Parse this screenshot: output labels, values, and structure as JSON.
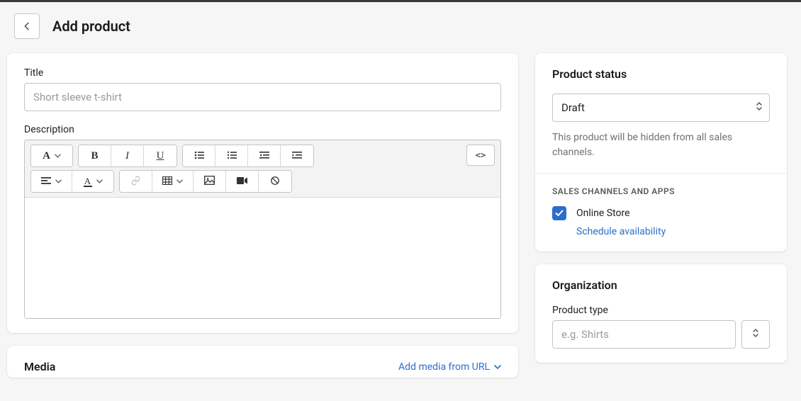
{
  "header": {
    "title": "Add product"
  },
  "main": {
    "title_label": "Title",
    "title_placeholder": "Short sleeve t-shirt",
    "description_label": "Description",
    "media": {
      "title": "Media",
      "add_url_label": "Add media from URL"
    },
    "rte_code_label": "<>"
  },
  "sidebar": {
    "status": {
      "title": "Product status",
      "selected": "Draft",
      "helper": "This product will be hidden from all sales channels."
    },
    "channels": {
      "heading": "SALES CHANNELS AND APPS",
      "items": [
        {
          "label": "Online Store",
          "checked": true
        }
      ],
      "schedule_label": "Schedule availability"
    },
    "organization": {
      "title": "Organization",
      "product_type_label": "Product type",
      "product_type_placeholder": "e.g. Shirts"
    }
  }
}
